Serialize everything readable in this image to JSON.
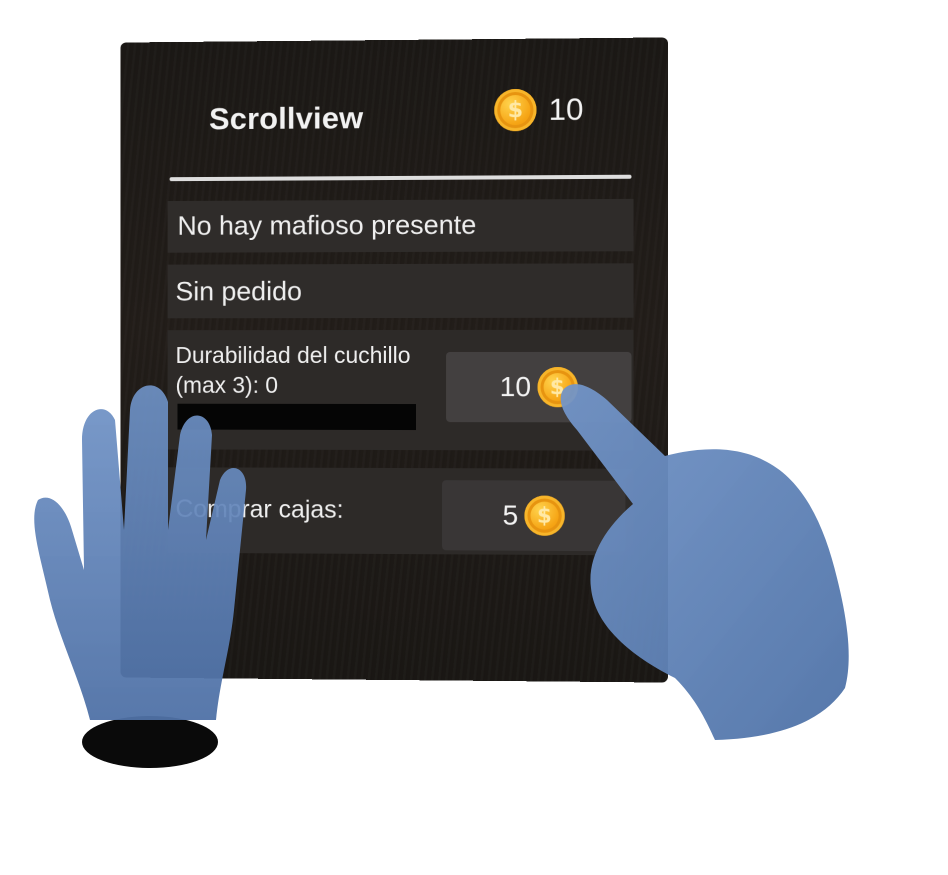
{
  "panel": {
    "title": "Scrollview",
    "balance": {
      "value": "10",
      "icon": "coin-icon",
      "coin_symbol": "$"
    }
  },
  "rows": {
    "mafioso_status": "No hay mafioso presente",
    "order_status": "Sin pedido",
    "knife": {
      "label": "Durabilidad del cuchillo (max 3): 0",
      "durability_fraction": 0,
      "price": "10",
      "coin_symbol": "$"
    },
    "boxes": {
      "label": "Comprar cajas:",
      "price": "5",
      "coin_symbol": "$"
    }
  },
  "colors": {
    "panel_bg": "#1e1a17",
    "row_bg": "#2f2c2a",
    "button_bg": "#434040",
    "coin": "#f6a414",
    "hand": "#5d80b3"
  }
}
